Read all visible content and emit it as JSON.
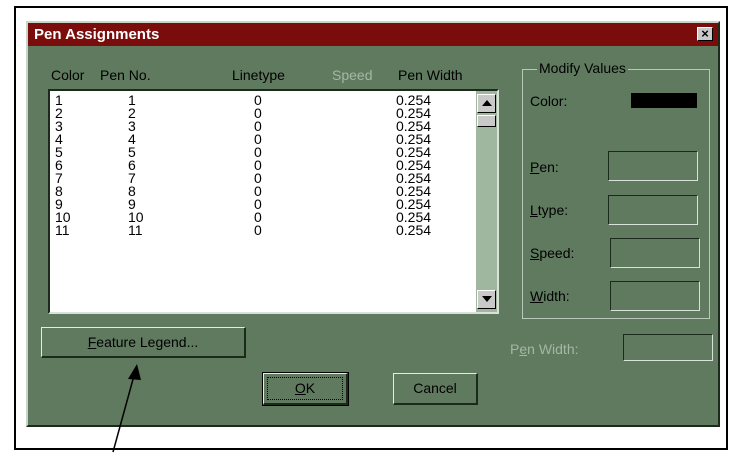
{
  "dialog": {
    "title": "Pen Assignments",
    "close_label": "×"
  },
  "columns": [
    "Color",
    "Pen No.",
    "Linetype",
    "Speed",
    "Pen Width"
  ],
  "rows": [
    {
      "color": "1",
      "pen": "1",
      "linetype": "0",
      "width": "0.254"
    },
    {
      "color": "2",
      "pen": "2",
      "linetype": "0",
      "width": "0.254"
    },
    {
      "color": "3",
      "pen": "3",
      "linetype": "0",
      "width": "0.254"
    },
    {
      "color": "4",
      "pen": "4",
      "linetype": "0",
      "width": "0.254"
    },
    {
      "color": "5",
      "pen": "5",
      "linetype": "0",
      "width": "0.254"
    },
    {
      "color": "6",
      "pen": "6",
      "linetype": "0",
      "width": "0.254"
    },
    {
      "color": "7",
      "pen": "7",
      "linetype": "0",
      "width": "0.254"
    },
    {
      "color": "8",
      "pen": "8",
      "linetype": "0",
      "width": "0.254"
    },
    {
      "color": "9",
      "pen": "9",
      "linetype": "0",
      "width": "0.254"
    },
    {
      "color": "10",
      "pen": "10",
      "linetype": "0",
      "width": "0.254"
    },
    {
      "color": "11",
      "pen": "11",
      "linetype": "0",
      "width": "0.254"
    }
  ],
  "modify": {
    "title": "Modify Values",
    "color_label": "Color:",
    "pen_label_u": "P",
    "pen_label_rest": "en:",
    "ltype_label_u": "L",
    "ltype_label_rest": "type:",
    "speed_label_u": "S",
    "speed_label_rest": "peed:",
    "width_label_u": "W",
    "width_label_rest": "idth:",
    "color_swatch": "#000000"
  },
  "pen_width": {
    "label_pre": "P",
    "label_u": "e",
    "label_rest": "n Width:"
  },
  "buttons": {
    "feature_legend_u": "F",
    "feature_legend_rest": "eature Legend...",
    "ok_u": "O",
    "ok_rest": "K",
    "cancel": "Cancel"
  }
}
